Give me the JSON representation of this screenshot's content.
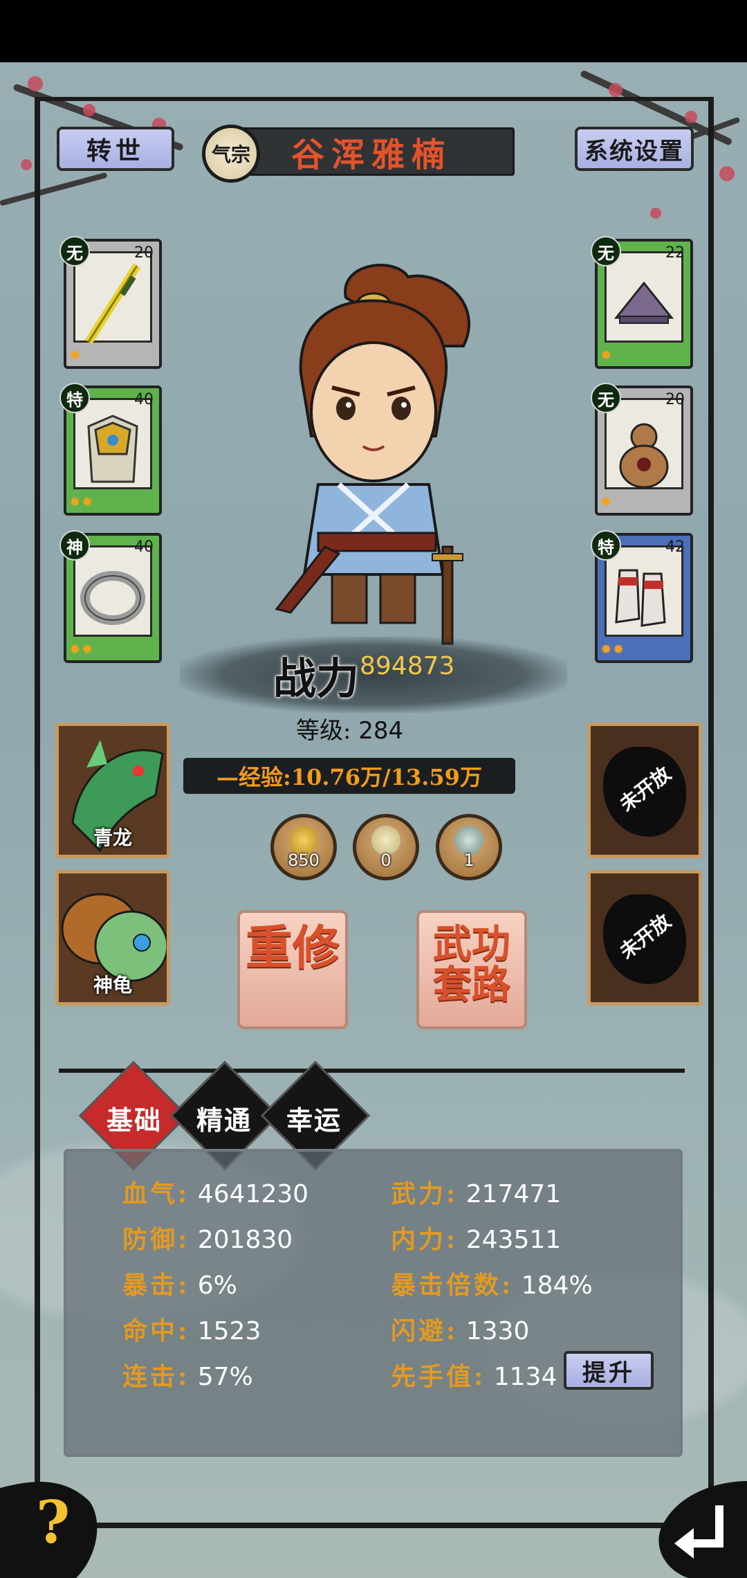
{
  "top_bar": {
    "rebirth_label": "转世",
    "sect_badge": "气宗",
    "player_name": "谷浑雅楠",
    "settings_label": "系统设置"
  },
  "equipment_left": [
    {
      "grade": "无",
      "level": "20",
      "icon": "sword-icon",
      "stars": "✹"
    },
    {
      "grade": "特",
      "level": "40",
      "icon": "armor-icon",
      "stars": "✹✹"
    },
    {
      "grade": "神",
      "level": "40",
      "icon": "ring-icon",
      "stars": "✹✹"
    }
  ],
  "equipment_right": [
    {
      "grade": "无",
      "level": "22",
      "icon": "hat-icon",
      "stars": "✹"
    },
    {
      "grade": "无",
      "level": "20",
      "icon": "gourd-icon",
      "stars": "✹"
    },
    {
      "grade": "特",
      "level": "42",
      "icon": "boots-icon",
      "stars": "✹✹"
    }
  ],
  "power": {
    "label": "战力",
    "value": "894873"
  },
  "level": {
    "label": "等级:",
    "value": "284"
  },
  "exp": {
    "text": "—经验:10.76万/13.59万"
  },
  "currencies": [
    {
      "icon": "gold-ingot-icon",
      "count": "850"
    },
    {
      "icon": "pearl-icon",
      "count": "0"
    },
    {
      "icon": "jade-icon",
      "count": "1"
    }
  ],
  "pets": [
    {
      "name": "青龙",
      "icon": "dragon-icon"
    },
    {
      "name": "神龟",
      "icon": "turtle-icon"
    }
  ],
  "locked_slots": [
    "未开放",
    "未开放"
  ],
  "actions": {
    "retrain_label": "重修",
    "martial_arts_label": "武功套路"
  },
  "tabs": [
    "基础",
    "精通",
    "幸运"
  ],
  "active_tab": "基础",
  "stats_left": [
    {
      "label": "血气:",
      "value": "4641230"
    },
    {
      "label": "防御:",
      "value": "201830"
    },
    {
      "label": "暴击:",
      "value": "6%"
    },
    {
      "label": "命中:",
      "value": "1523"
    },
    {
      "label": "连击:",
      "value": "57%"
    }
  ],
  "stats_right": [
    {
      "label": "武力:",
      "value": "217471"
    },
    {
      "label": "内力:",
      "value": "243511"
    },
    {
      "label": "暴击倍数:",
      "value": "184%"
    },
    {
      "label": "闪避:",
      "value": "1330"
    },
    {
      "label": "先手值:",
      "value": "1134"
    }
  ],
  "boost_label": "提升",
  "help_label": "?",
  "colors": {
    "accent_red": "#c72a2a",
    "stat_label": "#e29a22",
    "power_value": "#f2c94c",
    "exp_text": "#f39b1c",
    "name_text": "#e4532b"
  }
}
